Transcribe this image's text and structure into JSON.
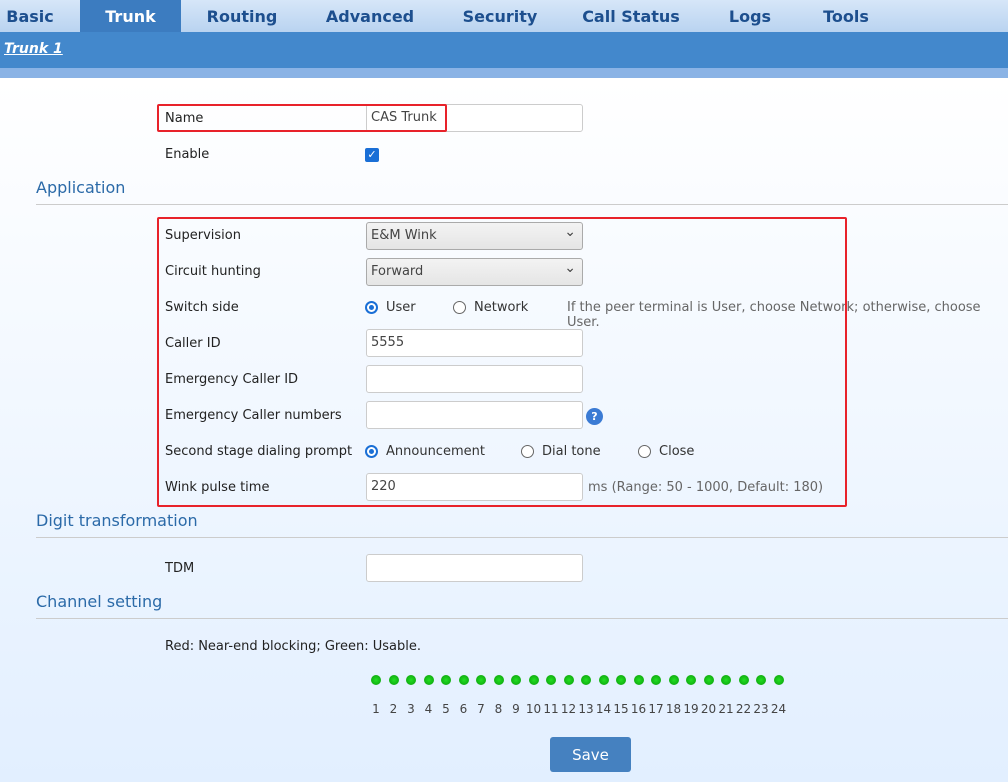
{
  "nav": {
    "tabs": [
      "Basic",
      "Trunk",
      "Routing",
      "Advanced",
      "Security",
      "Call Status",
      "Logs",
      "Tools"
    ],
    "active": "Trunk"
  },
  "subnav": {
    "link": "Trunk 1"
  },
  "form": {
    "name": {
      "label": "Name",
      "value": "CAS Trunk"
    },
    "enable": {
      "label": "Enable",
      "checked": true
    }
  },
  "application": {
    "title": "Application",
    "supervision": {
      "label": "Supervision",
      "value": "E&M Wink"
    },
    "circuit_hunting": {
      "label": "Circuit hunting",
      "value": "Forward"
    },
    "switch_side": {
      "label": "Switch side",
      "options": [
        "User",
        "Network"
      ],
      "selected": "User",
      "hint": "If the peer terminal is User, choose Network; otherwise, choose User."
    },
    "caller_id": {
      "label": "Caller ID",
      "value": "5555"
    },
    "emergency_caller_id": {
      "label": "Emergency Caller ID",
      "value": ""
    },
    "emergency_caller_numbers": {
      "label": "Emergency Caller numbers",
      "value": "",
      "help_icon": "?"
    },
    "second_stage": {
      "label": "Second stage dialing prompt",
      "options": [
        "Announcement",
        "Dial tone",
        "Close"
      ],
      "selected": "Announcement"
    },
    "wink_pulse": {
      "label": "Wink pulse time",
      "value": "220",
      "hint": "ms (Range: 50 - 1000, Default: 180)"
    }
  },
  "digit": {
    "title": "Digit transformation",
    "tdm": {
      "label": "TDM",
      "value": ""
    }
  },
  "channel": {
    "title": "Channel setting",
    "legend": "Red: Near-end blocking; Green: Usable.",
    "channels": [
      "1",
      "2",
      "3",
      "4",
      "5",
      "6",
      "7",
      "8",
      "9",
      "10",
      "11",
      "12",
      "13",
      "14",
      "15",
      "16",
      "17",
      "18",
      "19",
      "20",
      "21",
      "22",
      "23",
      "24"
    ],
    "status": "usable",
    "usable_color": "#11c011"
  },
  "save_label": "Save",
  "highlight_color": "#e8222a"
}
